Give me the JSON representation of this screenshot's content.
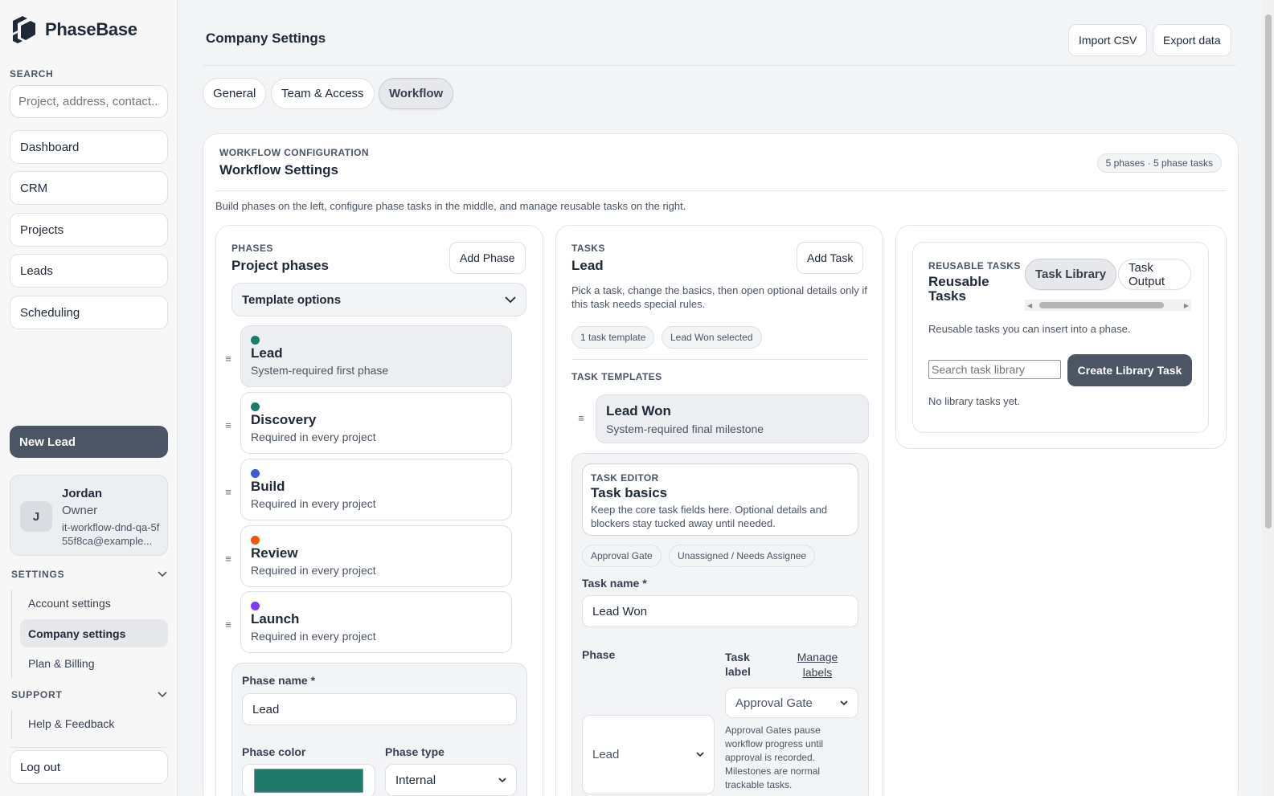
{
  "brand": {
    "name": "PhaseBase"
  },
  "sidebar": {
    "search_label": "SEARCH",
    "search_placeholder": "Project, address, contact...",
    "nav": [
      "Dashboard",
      "CRM",
      "Projects",
      "Leads",
      "Scheduling"
    ],
    "new_lead": "New Lead",
    "user": {
      "initial": "J",
      "name": "Jordan",
      "role": "Owner",
      "email": "it-workflow-dnd-qa-5f55f8ca@example..."
    },
    "settings": {
      "heading": "SETTINGS",
      "items": [
        "Account settings",
        "Company settings",
        "Plan & Billing"
      ],
      "active": "Company settings"
    },
    "support": {
      "heading": "SUPPORT",
      "items": [
        "Help & Feedback"
      ]
    },
    "logout": "Log out"
  },
  "header": {
    "title": "Company Settings",
    "import_csv": "Import CSV",
    "export_data": "Export data",
    "tabs": [
      "General",
      "Team & Access",
      "Workflow"
    ],
    "active_tab": "Workflow"
  },
  "workflow": {
    "kicker": "WORKFLOW CONFIGURATION",
    "title": "Workflow Settings",
    "summary": "5 phases · 5 phase tasks",
    "description": "Build phases on the left, configure phase tasks in the middle, and manage reusable tasks on the right."
  },
  "phases": {
    "kicker": "PHASES",
    "title": "Project phases",
    "add_button": "Add Phase",
    "template_options": "Template options",
    "items": [
      {
        "name": "Lead",
        "desc": "System-required first phase",
        "color": "#1f7a6b"
      },
      {
        "name": "Discovery",
        "desc": "Required in every project",
        "color": "#1f7a6b"
      },
      {
        "name": "Build",
        "desc": "Required in every project",
        "color": "#3b5bdb"
      },
      {
        "name": "Review",
        "desc": "Required in every project",
        "color": "#e8590c"
      },
      {
        "name": "Launch",
        "desc": "Required in every project",
        "color": "#7c3aed"
      }
    ],
    "form": {
      "name_label": "Phase name *",
      "name_value": "Lead",
      "color_label": "Phase color",
      "color_value": "#1f7a6b",
      "type_label": "Phase type",
      "type_value": "Internal"
    }
  },
  "tasks": {
    "kicker": "TASKS",
    "title": "Lead",
    "add_button": "Add Task",
    "description": "Pick a task, change the basics, then open optional details only if this task needs special rules.",
    "badges": [
      "1 task template",
      "Lead Won selected"
    ],
    "templates_heading": "TASK TEMPLATES",
    "template": {
      "name": "Lead Won",
      "desc": "System-required final milestone"
    },
    "editor": {
      "kicker": "TASK EDITOR",
      "title": "Task basics",
      "description": "Keep the core task fields here. Optional details and blockers stay tucked away until needed.",
      "badges": [
        "Approval Gate",
        "Unassigned / Needs Assignee"
      ],
      "name_label": "Task name *",
      "name_value": "Lead Won",
      "phase_label": "Phase",
      "phase_value": "Lead",
      "task_label_label": "Task label",
      "manage_labels": "Manage labels",
      "label_value": "Approval Gate",
      "help": "Approval Gates pause workflow progress until approval is recorded. Milestones are normal trackable tasks."
    }
  },
  "library": {
    "kicker": "REUSABLE TASKS",
    "title": "Reusable Tasks",
    "tabs": [
      "Task Library",
      "Task Output"
    ],
    "active_tab": "Task Library",
    "description": "Reusable tasks you can insert into a phase.",
    "search_placeholder": "Search task library",
    "create_button": "Create Library Task",
    "empty": "No library tasks yet."
  },
  "colors": {
    "accent": "#4b5563",
    "phase_teal": "#1f7a6b"
  },
  "icons": [
    "phasebase-logo-icon",
    "chevron-down-icon",
    "drag-handle-icon",
    "scroll-left-icon",
    "scroll-right-icon"
  ]
}
